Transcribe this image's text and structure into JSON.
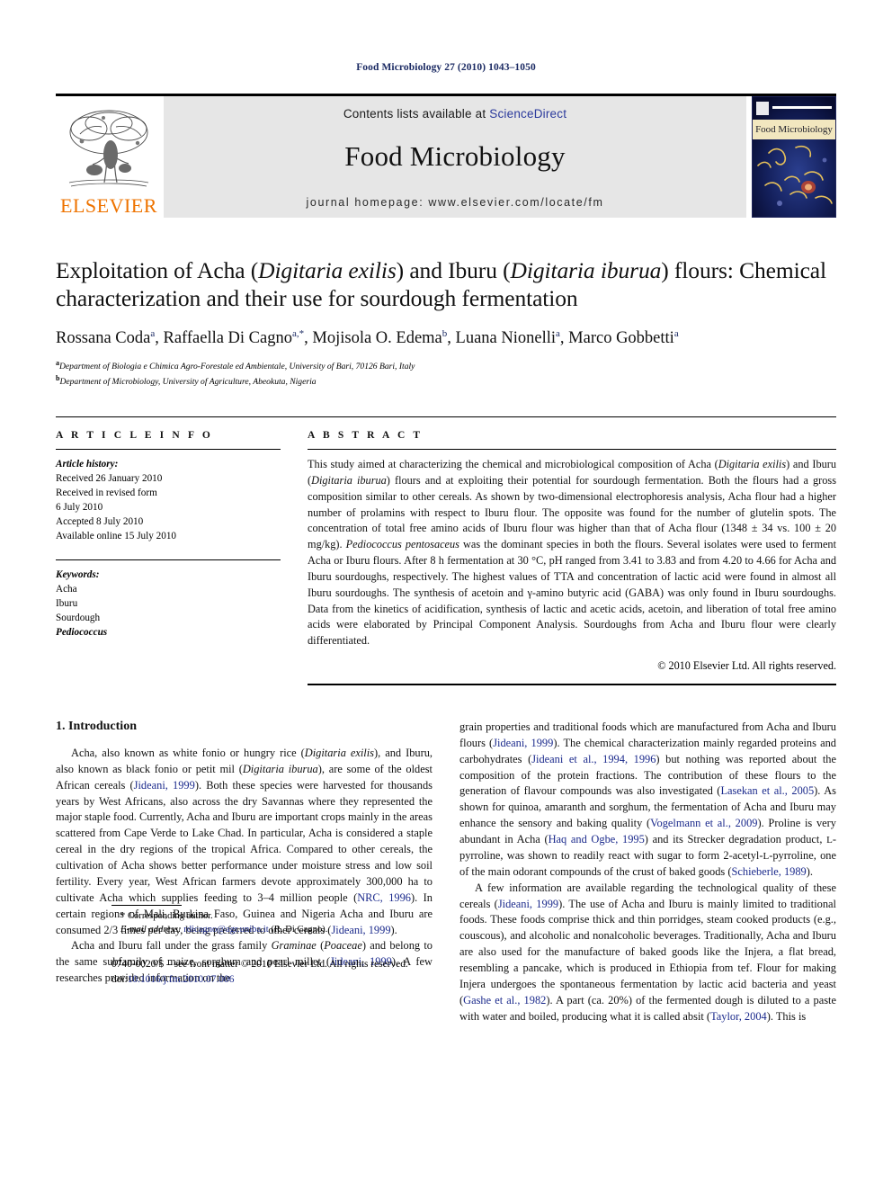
{
  "running_head": "Food Microbiology 27 (2010) 1043–1050",
  "masthead": {
    "publisher_name": "ELSEVIER",
    "contents_prefix": "Contents lists available at ",
    "contents_link": "ScienceDirect",
    "journal_title": "Food Microbiology",
    "homepage": "journal homepage: www.elsevier.com/locate/fm",
    "cover_title": "Food Microbiology",
    "accent_orange": "#ee7300",
    "link_blue": "#2b3a9c",
    "band_grey": "#e6e6e6"
  },
  "title": {
    "part1": "Exploitation of Acha (",
    "italic1": "Digitaria exilis",
    "part2": ") and Iburu (",
    "italic2": "Digitaria iburua",
    "part3": ") flours: Chemical characterization and their use for sourdough fermentation"
  },
  "authors_line": "Rossana Coda a, Raffaella Di Cagno a,*, Mojisola O. Edema b, Luana Nionelli a, Marco Gobbetti a",
  "affiliations": [
    {
      "marker": "a",
      "text": "Department of Biologia e Chimica Agro-Forestale ed Ambientale, University of Bari, 70126 Bari, Italy"
    },
    {
      "marker": "b",
      "text": "Department of Microbiology, University of Agriculture, Abeokuta, Nigeria"
    }
  ],
  "article_info": {
    "heading": "A R T I C L E  I N F O",
    "history_label": "Article history:",
    "history": [
      "Received 26 January 2010",
      "Received in revised form",
      "6 July 2010",
      "Accepted 8 July 2010",
      "Available online 15 July 2010"
    ],
    "keywords_label": "Keywords:",
    "keywords": [
      "Acha",
      "Iburu",
      "Sourdough",
      "Pediococcus"
    ],
    "keyword_italic_index": 3
  },
  "abstract": {
    "heading": "A B S T R A C T",
    "paragraph_pre": "This study aimed at characterizing the chemical and microbiological composition of Acha (",
    "it1": "Digitaria exilis",
    "mid1": ") and Iburu (",
    "it2": "Digitaria iburua",
    "mid2": ") flours and at exploiting their potential for sourdough fermentation. Both the flours had a gross composition similar to other cereals. As shown by two-dimensional electrophoresis analysis, Acha flour had a higher number of prolamins with respect to Iburu flour. The opposite was found for the number of glutelin spots. The concentration of total free amino acids of Iburu flour was higher than that of Acha flour (1348 ± 34 vs. 100 ± 20 mg/kg). ",
    "it3": "Pediococcus pentosaceus",
    "mid3": " was the dominant species in both the flours. Several isolates were used to ferment Acha or Iburu flours. After 8 h fermentation at 30 °C, pH ranged from 3.41 to 3.83 and from 4.20 to 4.66 for Acha and Iburu sourdoughs, respectively. The highest values of TTA and concentration of lactic acid were found in almost all Iburu sourdoughs. The synthesis of acetoin and γ-amino butyric acid (GABA) was only found in Iburu sourdoughs. Data from the kinetics of acidification, synthesis of lactic and acetic acids, acetoin, and liberation of total free amino acids were elaborated by Principal Component Analysis. Sourdoughs from Acha and Iburu flour were clearly differentiated.",
    "copyright": "© 2010 Elsevier Ltd. All rights reserved."
  },
  "body": {
    "section_title": "1. Introduction",
    "left_paragraphs": [
      {
        "runs": [
          {
            "t": "Acha, also known as white fonio or hungry rice ("
          },
          {
            "t": "Digitaria exilis",
            "s": "it"
          },
          {
            "t": "), and Iburu, also known as black fonio or petit mil ("
          },
          {
            "t": "Digitaria iburua",
            "s": "it"
          },
          {
            "t": "), are some of the oldest African cereals ("
          },
          {
            "t": "Jideani, 1999",
            "s": "ref"
          },
          {
            "t": "). Both these species were harvested for thousands years by West Africans, also across the dry Savannas where they represented the major staple food. Currently, Acha and Iburu are important crops mainly in the areas scattered from Cape Verde to Lake Chad. In particular, Acha is considered a staple cereal in the dry regions of the tropical Africa. Compared to other cereals, the cultivation of Acha shows better performance under moisture stress and low soil fertility. Every year, West African farmers devote approximately 300,000 ha to cultivate Acha which supplies feeding to 3–4 million people ("
          },
          {
            "t": "NRC, 1996",
            "s": "ref"
          },
          {
            "t": "). In certain regions of Mali, Burkina Faso, Guinea and Nigeria Acha and Iburu are consumed 2/3 times per day, being preferred to other cereals ("
          },
          {
            "t": "Jideani, 1999",
            "s": "ref"
          },
          {
            "t": ")."
          }
        ]
      },
      {
        "runs": [
          {
            "t": "Acha and Iburu fall under the grass family "
          },
          {
            "t": "Graminae",
            "s": "it"
          },
          {
            "t": " ("
          },
          {
            "t": "Poaceae",
            "s": "it"
          },
          {
            "t": ") and belong to the same subfamily of maize, sorghum and pearl millet ("
          },
          {
            "t": "Jideani, 1999",
            "s": "ref"
          },
          {
            "t": "). A few researches provided information on the"
          }
        ]
      }
    ],
    "right_paragraphs": [
      {
        "runs": [
          {
            "t": "grain properties and traditional foods which are manufactured from Acha and Iburu flours ("
          },
          {
            "t": "Jideani, 1999",
            "s": "ref"
          },
          {
            "t": "). The chemical characterization mainly regarded proteins and carbohydrates ("
          },
          {
            "t": "Jideani et al., 1994, 1996",
            "s": "ref"
          },
          {
            "t": ") but nothing was reported about the composition of the protein fractions. The contribution of these flours to the generation of flavour compounds was also investigated ("
          },
          {
            "t": "Lasekan et al., 2005",
            "s": "ref"
          },
          {
            "t": "). As shown for quinoa, amaranth and sorghum, the fermentation of Acha and Iburu may enhance the sensory and baking quality ("
          },
          {
            "t": "Vogelmann et al., 2009",
            "s": "ref"
          },
          {
            "t": "). Proline is very abundant in Acha ("
          },
          {
            "t": "Haq and Ogbe, 1995",
            "s": "ref"
          },
          {
            "t": ") and its Strecker degradation product, "
          },
          {
            "t": "L",
            "s": "sc"
          },
          {
            "t": "-pyrroline, was shown to readily react with sugar to form 2-acetyl-"
          },
          {
            "t": "L",
            "s": "sc"
          },
          {
            "t": "-pyrroline, one of the main odorant compounds of the crust of baked goods ("
          },
          {
            "t": "Schieberle, 1989",
            "s": "ref"
          },
          {
            "t": ")."
          }
        ]
      },
      {
        "runs": [
          {
            "t": "A few information are available regarding the technological quality of these cereals ("
          },
          {
            "t": "Jideani, 1999",
            "s": "ref"
          },
          {
            "t": "). The use of Acha and Iburu is mainly limited to traditional foods. These foods comprise thick and thin porridges, steam cooked products (e.g., couscous), and alcoholic and nonalcoholic beverages. Traditionally, Acha and Iburu are also used for the manufacture of baked goods like the Injera, a flat bread, resembling a pancake, which is produced in Ethiopia from tef. Flour for making Injera undergoes the spontaneous fermentation by lactic acid bacteria and yeast ("
          },
          {
            "t": "Gashe et al., 1982",
            "s": "ref"
          },
          {
            "t": "). A part (ca. 20%) of the fermented dough is diluted to a paste with water and boiled, producing what it is called absit ("
          },
          {
            "t": "Taylor, 2004",
            "s": "ref"
          },
          {
            "t": "). This is"
          }
        ]
      }
    ]
  },
  "footnote": {
    "corresponding": "* Corresponding author.",
    "email_label": "E-mail address:",
    "email": "rdicagno@agr.uniba.it",
    "email_suffix": " (R. Di Cagno)."
  },
  "colophon": {
    "line1": "0740-0020/$ – see front matter © 2010 Elsevier Ltd. All rights reserved.",
    "doi_label": "doi:",
    "doi": "10.1016/j.fm.2010.07.006"
  }
}
